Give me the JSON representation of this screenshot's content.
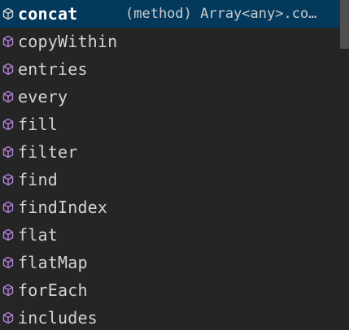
{
  "colors": {
    "background": "#252526",
    "selected_background": "#04395e",
    "method_icon": "#b180d7",
    "text": "#d4d4d4",
    "scrollbar_thumb": "#4f4f4f"
  },
  "suggestions": [
    {
      "label": "concat",
      "detail": "(method) Array<any>.co…",
      "icon": "method-cube-icon",
      "selected": true
    },
    {
      "label": "copyWithin",
      "icon": "method-cube-icon"
    },
    {
      "label": "entries",
      "icon": "method-cube-icon"
    },
    {
      "label": "every",
      "icon": "method-cube-icon"
    },
    {
      "label": "fill",
      "icon": "method-cube-icon"
    },
    {
      "label": "filter",
      "icon": "method-cube-icon"
    },
    {
      "label": "find",
      "icon": "method-cube-icon"
    },
    {
      "label": "findIndex",
      "icon": "method-cube-icon"
    },
    {
      "label": "flat",
      "icon": "method-cube-icon"
    },
    {
      "label": "flatMap",
      "icon": "method-cube-icon"
    },
    {
      "label": "forEach",
      "icon": "method-cube-icon"
    },
    {
      "label": "includes",
      "icon": "method-cube-icon"
    }
  ]
}
